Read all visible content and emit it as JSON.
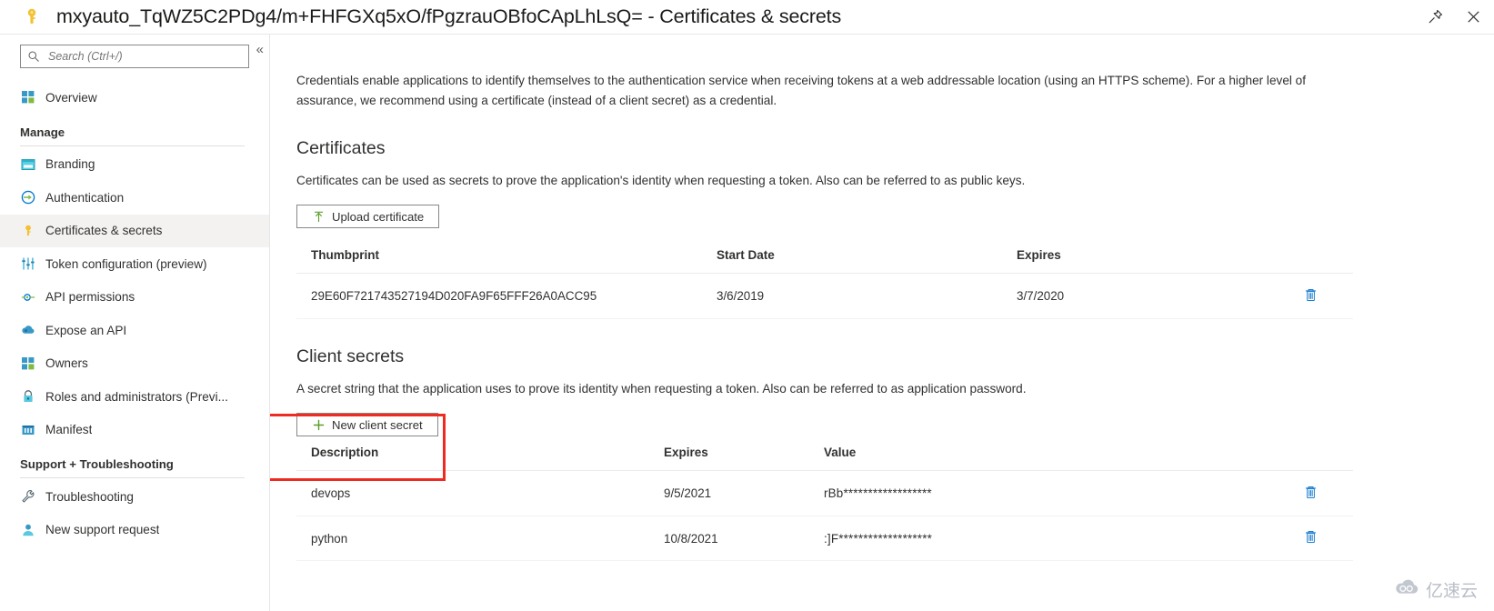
{
  "titlebar": {
    "icon": "key-icon",
    "title": "mxyauto_TqWZ5C2PDg4/m+FHFGXq5xO/fPgzrauOBfoCApLhLsQ= - Certificates & secrets",
    "pin_icon": "pin-icon",
    "close_icon": "close-icon"
  },
  "sidebar": {
    "collapse_icon": "double-chevron-left-icon",
    "search": {
      "icon": "search-icon",
      "placeholder": "Search (Ctrl+/)",
      "value": ""
    },
    "top_items": [
      {
        "label": "Overview",
        "icon": "overview-grid-icon",
        "selected": false
      }
    ],
    "groups": [
      {
        "title": "Manage",
        "items": [
          {
            "label": "Branding",
            "icon": "branding-icon",
            "selected": false
          },
          {
            "label": "Authentication",
            "icon": "authentication-icon",
            "selected": false
          },
          {
            "label": "Certificates & secrets",
            "icon": "key-icon",
            "selected": true
          },
          {
            "label": "Token configuration (preview)",
            "icon": "sliders-icon",
            "selected": false
          },
          {
            "label": "API permissions",
            "icon": "api-permissions-icon",
            "selected": false
          },
          {
            "label": "Expose an API",
            "icon": "cloud-icon",
            "selected": false
          },
          {
            "label": "Owners",
            "icon": "owners-grid-icon",
            "selected": false
          },
          {
            "label": "Roles and administrators (Previ...",
            "icon": "roles-lock-icon",
            "selected": false
          },
          {
            "label": "Manifest",
            "icon": "manifest-icon",
            "selected": false
          }
        ]
      },
      {
        "title": "Support + Troubleshooting",
        "items": [
          {
            "label": "Troubleshooting",
            "icon": "wrench-icon",
            "selected": false
          },
          {
            "label": "New support request",
            "icon": "person-icon",
            "selected": false
          }
        ]
      }
    ]
  },
  "main": {
    "intro": "Credentials enable applications to identify themselves to the authentication service when receiving tokens at a web addressable location (using an HTTPS scheme). For a higher level of assurance, we recommend using a certificate (instead of a client secret) as a credential.",
    "certificates": {
      "heading": "Certificates",
      "description": "Certificates can be used as secrets to prove the application's identity when requesting a token. Also can be referred to as public keys.",
      "upload_button": {
        "label": "Upload certificate",
        "icon": "upload-arrow-icon"
      },
      "columns": [
        "Thumbprint",
        "Start Date",
        "Expires",
        ""
      ],
      "rows": [
        {
          "thumbprint": "29E60F721743527194D020FA9F65FFF26A0ACC95",
          "start_date": "3/6/2019",
          "expires": "3/7/2020",
          "delete_icon": "trash-icon"
        }
      ]
    },
    "client_secrets": {
      "heading": "Client secrets",
      "description": "A secret string that the application uses to prove its identity when requesting a token. Also can be referred to as application password.",
      "new_button": {
        "label": "New client secret",
        "icon": "plus-icon"
      },
      "columns": [
        "Description",
        "Expires",
        "Value",
        ""
      ],
      "rows": [
        {
          "description": "devops",
          "expires": "9/5/2021",
          "value": "rBb******************",
          "delete_icon": "trash-icon"
        },
        {
          "description": "python",
          "expires": "10/8/2021",
          "value": ":]F*******************",
          "delete_icon": "trash-icon"
        }
      ]
    }
  },
  "annotation": {
    "highlight_color": "#ee2b21",
    "target": "new-client-secret-button"
  },
  "watermark": {
    "text": "亿速云",
    "icon": "cloud-logo-icon"
  }
}
